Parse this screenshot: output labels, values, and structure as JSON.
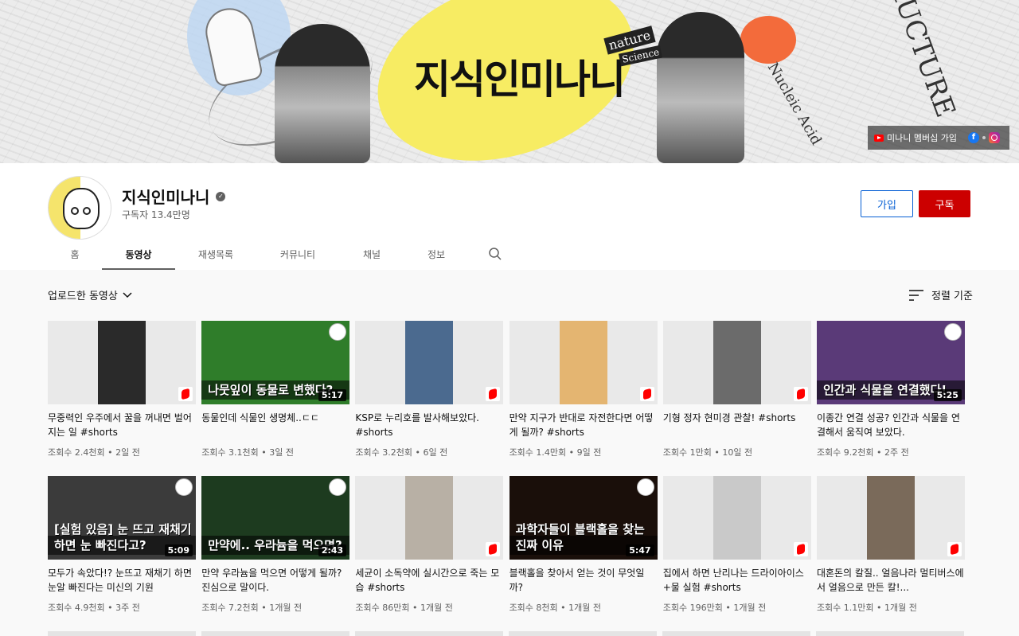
{
  "banner": {
    "title": "지식인미나니",
    "decor_words": [
      "STRUCTURE OF",
      "Nucleic Acid",
      "nature",
      "Science"
    ],
    "links_text": "미나니 멤버십 가입",
    "colors": {
      "yellow": "#f7ec63",
      "blue": "#bcd6f2",
      "orange": "#f36b3b"
    }
  },
  "channel": {
    "name": "지식인미나니",
    "subscribers": "구독자 13.4만명",
    "join_label": "가입",
    "subscribe_label": "구독",
    "verified_icon": "check-icon"
  },
  "tabs": [
    "홈",
    "동영상",
    "재생목록",
    "커뮤니티",
    "채널",
    "정보"
  ],
  "active_tab": "동영상",
  "filter": {
    "label": "업로드한 동영상",
    "sort_label": "정렬 기준"
  },
  "videos": [
    {
      "title": "무중력인 우주에서 꿀을 꺼내면 벌어지는 일 #shorts",
      "views": "조회수 2.4천회",
      "age": "2일 전",
      "shorts": true,
      "thumb_color": "#2a2a2a",
      "thumb_text": ""
    },
    {
      "title": "동물인데 식물인 생명체..ㄷㄷ",
      "views": "조회수 3.1천회",
      "age": "3일 전",
      "shorts": false,
      "duration": "5:17",
      "thumb_color": "#2f7d2a",
      "thumb_text": "나뭇잎이 동물로 변했다?"
    },
    {
      "title": "KSP로 누리호를 발사해보았다. #shorts",
      "views": "조회수 3.2천회",
      "age": "6일 전",
      "shorts": true,
      "thumb_color": "#4b6a8f",
      "thumb_text": ""
    },
    {
      "title": "만약 지구가 반대로 자전한다면 어떻게 될까? #shorts",
      "views": "조회수 1.4만회",
      "age": "9일 전",
      "shorts": true,
      "thumb_color": "#e4b571",
      "thumb_text": ""
    },
    {
      "title": "기형 정자 현미경 관찰! #shorts",
      "views": "조회수 1만회",
      "age": "10일 전",
      "shorts": true,
      "thumb_color": "#6b6b6b",
      "thumb_text": ""
    },
    {
      "title": "이종간 연결 성공? 인간과 식물을 연결해서 움직여 보았다.",
      "views": "조회수 9.2천회",
      "age": "2주 전",
      "shorts": false,
      "duration": "5:25",
      "thumb_color": "#5a3a78",
      "thumb_text": "인간과 식물을 연결했다!"
    },
    {
      "title": "모두가 속았다!? 눈뜨고 재채기 하면 눈알 빠진다는 미신의 기원",
      "views": "조회수 4.9천회",
      "age": "3주 전",
      "shorts": false,
      "duration": "5:09",
      "thumb_color": "#3b3b3b",
      "thumb_text": "[실험 있음] 눈 뜨고 재채기하면 눈 빠진다고?"
    },
    {
      "title": "만약 우라늄을 먹으면 어떻게 될까? 진심으로 말이다.",
      "views": "조회수 7.2천회",
      "age": "1개월 전",
      "shorts": false,
      "duration": "2:43",
      "thumb_color": "#1d3b1f",
      "thumb_text": "만약에.. 우라늄을 먹으면?"
    },
    {
      "title": "세균이 소독약에 실시간으로 죽는 모습 #shorts",
      "views": "조회수 86만회",
      "age": "1개월 전",
      "shorts": true,
      "thumb_color": "#b8b0a5",
      "thumb_text": ""
    },
    {
      "title": "블랙홀을 찾아서 얻는 것이 무엇일까?",
      "views": "조회수 8천회",
      "age": "1개월 전",
      "shorts": false,
      "duration": "5:47",
      "thumb_color": "#1a0f0a",
      "thumb_text": "과학자들이 블랙홀을 찾는 진짜 이유"
    },
    {
      "title": "집에서 하면 난리나는 드라이아이스+물 실험 #shorts",
      "views": "조회수 196만회",
      "age": "1개월 전",
      "shorts": true,
      "thumb_color": "#c9c9c9",
      "thumb_text": ""
    },
    {
      "title": "대혼돈의 칼질.. 얼음나라 멀티버스에서 얼음으로 만든 칼!...",
      "views": "조회수 1.1만회",
      "age": "1개월 전",
      "shorts": true,
      "thumb_color": "#7a6a5a",
      "thumb_text": ""
    }
  ]
}
